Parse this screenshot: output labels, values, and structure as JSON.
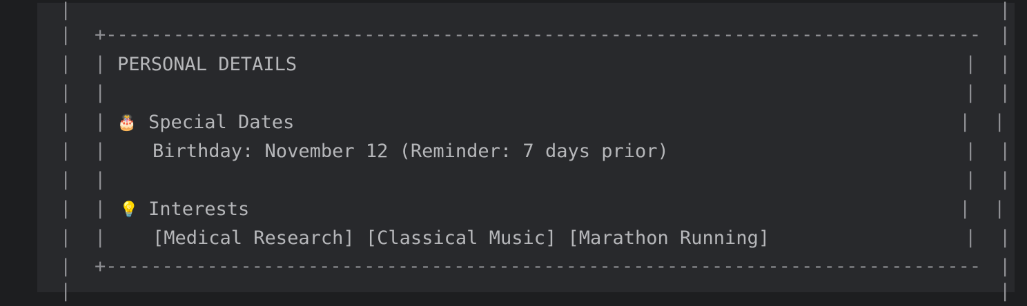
{
  "section": {
    "title": "PERSONAL DETAILS"
  },
  "special_dates": {
    "icon": "birthday-cake-icon",
    "heading": "Special Dates",
    "birthday_line": "Birthday: November 12 (Reminder: 7 days prior)"
  },
  "interests": {
    "icon": "lightbulb-icon",
    "heading": "Interests",
    "tags": [
      "[Medical Research]",
      "[Classical Music]",
      "[Marathon Running]"
    ]
  },
  "colors": {
    "background": "#28292c",
    "text": "#b6b7ba",
    "border": "#8f9094"
  }
}
